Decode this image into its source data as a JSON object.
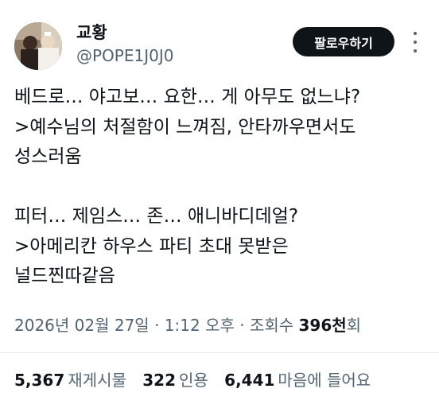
{
  "author": {
    "display_name": "교황",
    "handle": "@POPE1J0J0"
  },
  "follow_button_label": "팔로우하기",
  "tweet": {
    "lines": [
      "베드로… 야고보… 요한… 게 아무도 없느냐?",
      ">예수님의 처절함이 느껴짐, 안타까우면서도",
      "성스러움",
      "",
      "피터… 제임스… 존… 애니바디데얼?",
      ">아메리칸 하우스 파티 초대 못받은",
      "널드찐따같음"
    ]
  },
  "meta": {
    "date": "2026년 02월 27일",
    "separator": " · ",
    "time": "1:12 오후",
    "views_label": "조회수",
    "views_count": "396천",
    "views_unit": "회"
  },
  "stats": {
    "reposts": {
      "count": "5,367",
      "label": "재게시물"
    },
    "quotes": {
      "count": "322",
      "label": "인용"
    },
    "likes": {
      "count": "6,441",
      "label": "마음에 들어요"
    }
  },
  "icons": {
    "more": "more-vertical-icon"
  }
}
